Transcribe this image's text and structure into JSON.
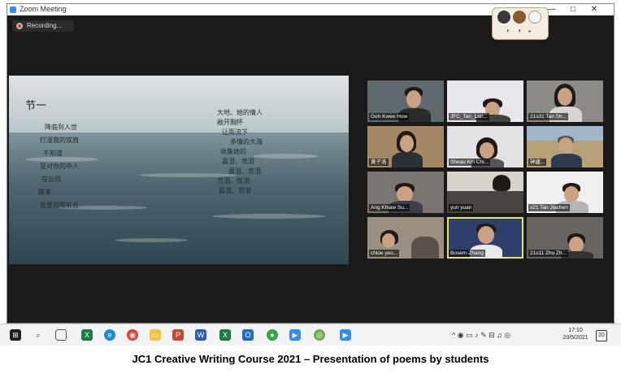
{
  "window": {
    "title": "Zoom Meeting",
    "minimize_glyph": "—",
    "maximize_glyph": "□",
    "close_glyph": "✕"
  },
  "recording": {
    "label": "Recording..."
  },
  "badge": {
    "icons": "◐ ◑ ◒"
  },
  "slide": {
    "title": "节一",
    "left_lines": [
      "降临到人世",
      "打湿我的双肩",
      "不知道",
      "是对你的中人",
      "在云间",
      "飘来",
      "恼里的雨前云"
    ],
    "right_lines": [
      "大地、她的情人",
      "敞开胸怀",
      "让雨流下",
      "多情的大海",
      "收集她的",
      "喜泪、悲泪",
      "喜泪、悲泪",
      "恋泪、恨泪",
      "喜泪、悲泪"
    ]
  },
  "participants": [
    {
      "name": "Goh Kwee How"
    },
    {
      "name": "JFC_Tan_Lan..."
    },
    {
      "name": "21s31 Tan Sh..."
    },
    {
      "name": "黄子洛"
    },
    {
      "name": "Sheau Kin Chi..."
    },
    {
      "name": "钟建..."
    },
    {
      "name": "Ang Khiaw Su..."
    },
    {
      "name": "yun yuan"
    },
    {
      "name": "s21 Tan Jiachen"
    },
    {
      "name": "chloe yeo..."
    },
    {
      "name": "Bosern Zhang"
    },
    {
      "name": "21s11 Zhu Zh..."
    }
  ],
  "taskbar": {
    "icons": [
      "windows-start-icon",
      "search-icon",
      "task-view-icon",
      "excel-icon",
      "edge-icon",
      "chrome-icon",
      "file-explorer-icon",
      "powerpoint-icon",
      "word-icon",
      "excel-icon",
      "outlook-icon",
      "app-icon",
      "zoom-icon",
      "app-icon",
      "zoom-icon"
    ],
    "tray": "^ ◉ ▭ ♪ ✎ ⊟ ♫ ◎",
    "time": "17:10",
    "date": "20/5/2021",
    "notif_count": "20"
  },
  "caption": "JC1 Creative Writing Course 2021 – Presentation of poems by students",
  "colors": {
    "zoom_blue": "#2d8cff",
    "active_speaker": "#e7e35a",
    "window_bg": "#1b1b1b"
  }
}
